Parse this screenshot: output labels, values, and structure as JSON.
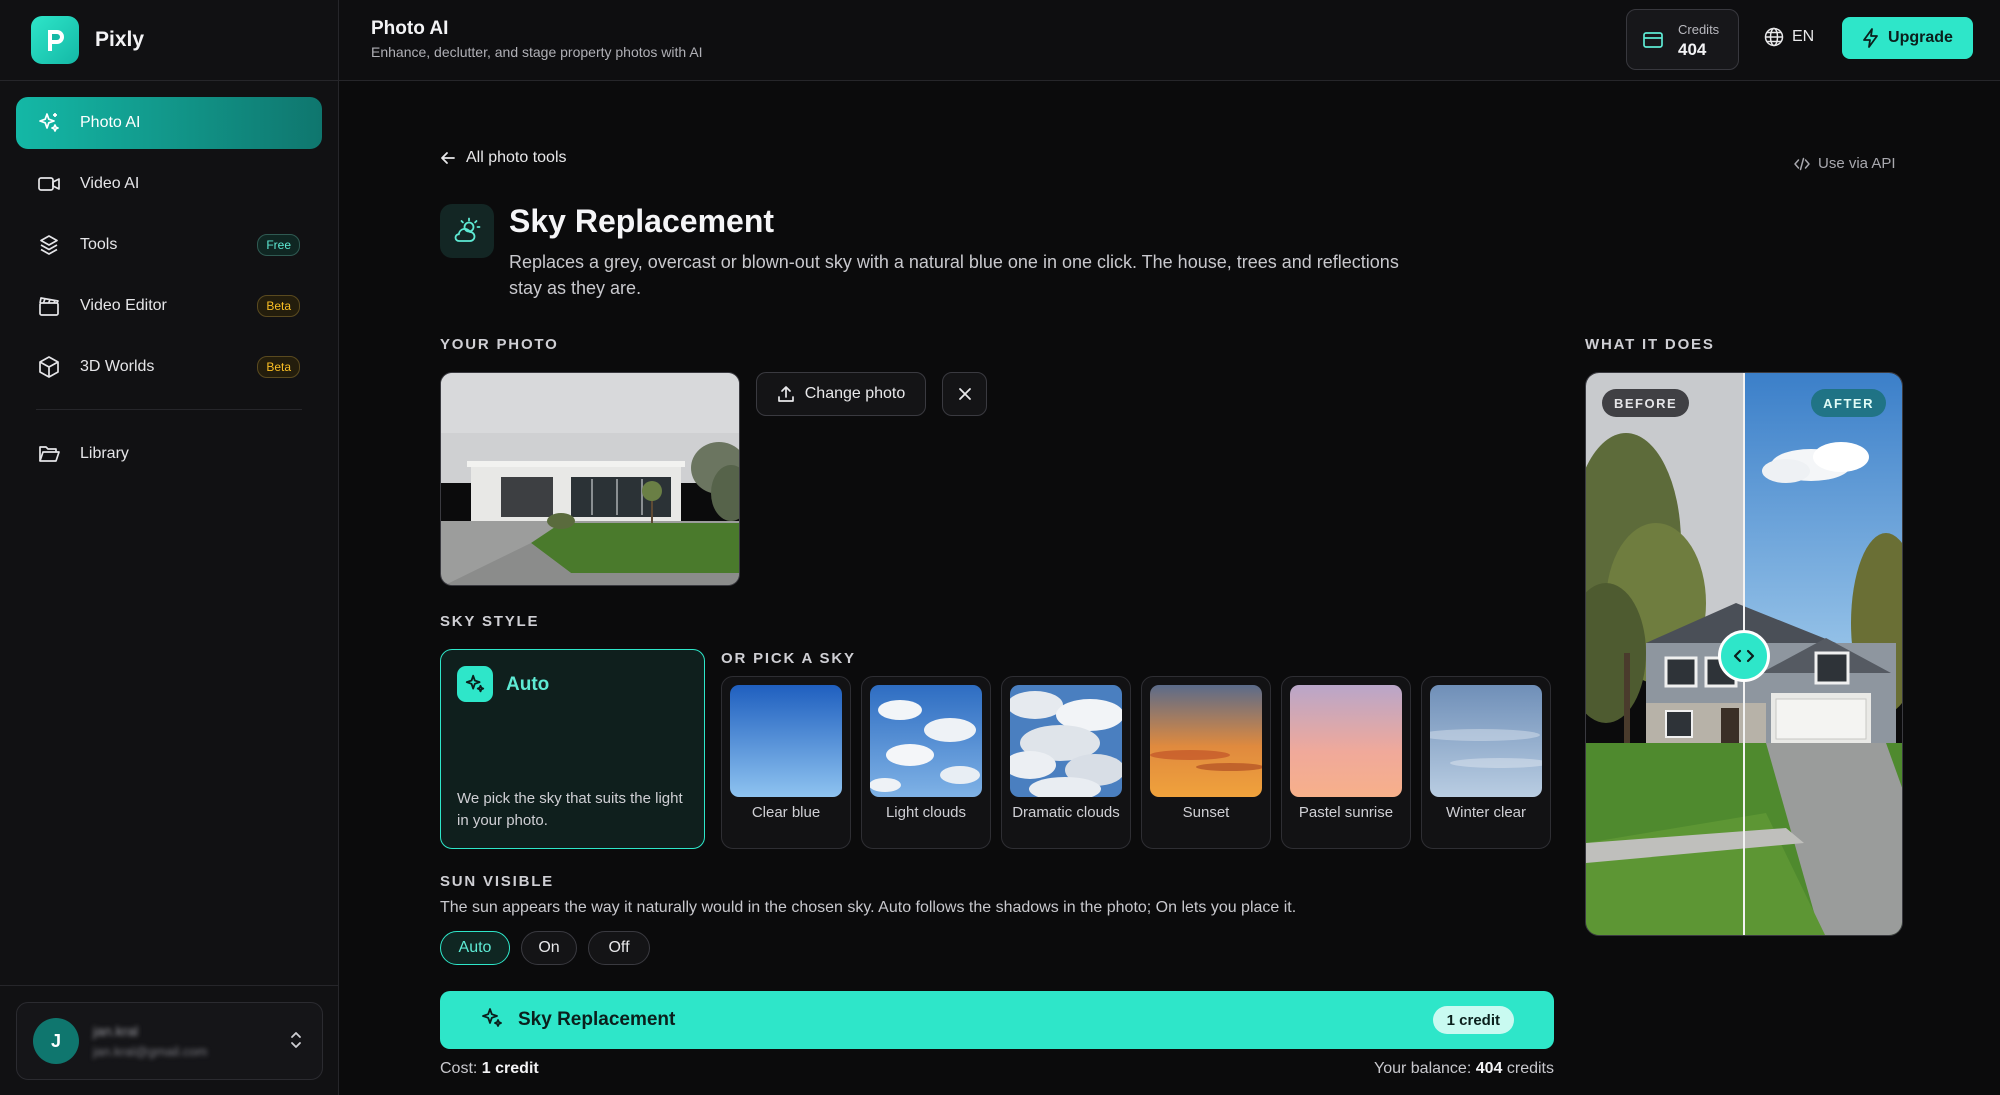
{
  "brand": {
    "name": "Pixly"
  },
  "colors": {
    "accent": "#2ee6c9",
    "accent_dark": "#0f766e",
    "background": "#0b0b0c",
    "beta": "#fbbf24"
  },
  "sidebar": {
    "items": [
      {
        "label": "Photo AI",
        "icon": "sparkles-icon",
        "active": true
      },
      {
        "label": "Video AI",
        "icon": "video-camera-icon"
      },
      {
        "label": "Tools",
        "icon": "toolbox-icon",
        "badge": "Free"
      },
      {
        "label": "Video Editor",
        "icon": "clapperboard-icon",
        "badge": "Beta"
      },
      {
        "label": "3D Worlds",
        "icon": "cube-icon",
        "badge": "Beta"
      },
      {
        "label": "Library",
        "icon": "folder-open-icon"
      }
    ],
    "user": {
      "initial": "J",
      "name": "jan.kral",
      "email": "jan.kral@gmail.com"
    }
  },
  "header": {
    "title": "Photo AI",
    "subtitle": "Enhance, declutter, and stage property photos with AI",
    "credits_label": "Credits",
    "credits_value": "404",
    "language": "EN",
    "upgrade_label": "Upgrade"
  },
  "main": {
    "back_label": "All photo tools",
    "api_label": "Use via API",
    "tool_title": "Sky Replacement",
    "tool_description": "Replaces a grey, overcast or blown-out sky with a natural blue one in one click. The house, trees and reflections stay as they are.",
    "your_photo_label": "YOUR PHOTO",
    "change_photo_label": "Change photo",
    "what_it_does_label": "WHAT IT DOES",
    "before_label": "BEFORE",
    "after_label": "AFTER",
    "sky_style_label": "SKY STYLE",
    "auto_title": "Auto",
    "auto_description": "We pick the sky that suits the light in your photo.",
    "or_pick_label": "OR PICK A SKY",
    "skies": [
      {
        "label": "Clear blue"
      },
      {
        "label": "Light clouds"
      },
      {
        "label": "Dramatic clouds"
      },
      {
        "label": "Sunset"
      },
      {
        "label": "Pastel sunrise"
      },
      {
        "label": "Winter clear"
      }
    ],
    "sun_visible_label": "SUN VISIBLE",
    "sun_description": "The sun appears the way it naturally would in the chosen sky. Auto follows the shadows in the photo; On lets you place it.",
    "sun_options": [
      {
        "label": "Auto",
        "selected": true
      },
      {
        "label": "On"
      },
      {
        "label": "Off"
      }
    ],
    "run_label": "Sky Replacement",
    "run_badge": "1 credit",
    "cost_prefix": "Cost:",
    "cost_value": "1 credit",
    "balance_prefix": "Your balance:",
    "balance_value": "404",
    "balance_suffix": "credits"
  }
}
